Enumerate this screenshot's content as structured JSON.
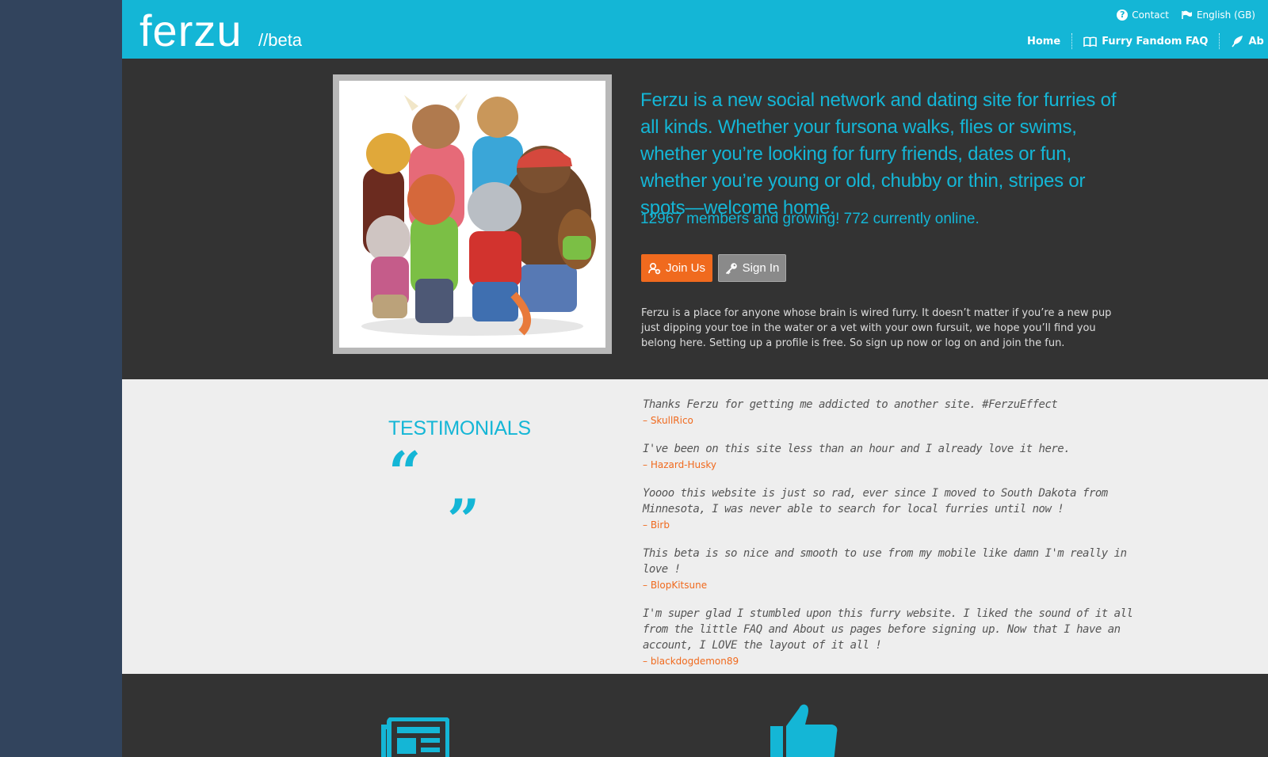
{
  "brand": {
    "logo": "ferzu",
    "suffix": "//beta"
  },
  "top_links": {
    "contact": "Contact",
    "language": "English (GB)"
  },
  "nav": {
    "home": "Home",
    "faq": "Furry Fandom FAQ",
    "about": "Ab"
  },
  "hero": {
    "tagline": "Ferzu is a new social network and dating site for furries of all kinds. Whether your fursona walks, flies or swims, whether you’re looking for furry friends, dates or fun, whether you’re young or old, chubby or thin, stripes or spots—welcome home.",
    "members": "12967 members and growing! 772 currently online.",
    "join_label": "Join Us",
    "signin_label": "Sign In",
    "intro": "Ferzu is a place for anyone whose brain is wired furry. It doesn’t matter if you’re a new pup just dipping your toe in the water or a vet with your own fursuit, we hope you’ll find you belong here. Setting up a profile is free. So sign up now or log on and join the fun."
  },
  "testimonials": {
    "title": "TESTIMONIALS",
    "open_quote": "“",
    "close_quote": "”",
    "items": [
      {
        "text": "Thanks Ferzu for getting me addicted to another site. #FerzuEffect",
        "author": "– SkullRico"
      },
      {
        "text": "I've been on this site less than an hour and I already love it here.",
        "author": "– Hazard-Husky"
      },
      {
        "text": "Yoooo this website is just so rad, ever since I moved to South Dakota from Minnesota, I was never able to search for local furries until now !",
        "author": "– Birb"
      },
      {
        "text": "This beta is so nice and smooth to use from my mobile like damn I'm really in love !",
        "author": "– BlopKitsune"
      },
      {
        "text": "I'm super glad I stumbled upon this furry website. I liked the sound of it all from the little FAQ and About us pages before signing up. Now that I have an account, I LOVE the layout of it all !",
        "author": "– blackdogdemon89"
      }
    ]
  },
  "colors": {
    "accent": "#14b6d6",
    "orange": "#f06a1e",
    "dark": "#333333",
    "sidebar": "#32445d",
    "light": "#eeeeee"
  },
  "icons": [
    "help-circle-icon",
    "flag-icon",
    "book-icon",
    "feather-icon",
    "user-plus-icon",
    "key-icon",
    "newspaper-icon",
    "thumbs-up-icon"
  ]
}
